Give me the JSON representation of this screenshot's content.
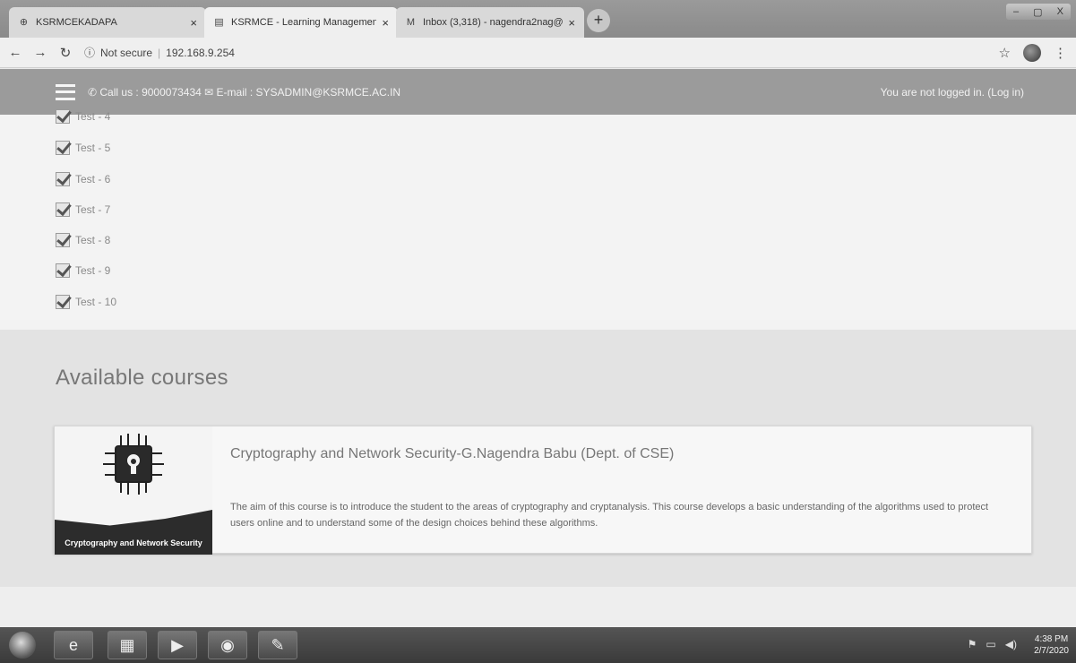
{
  "browser": {
    "tabs": [
      {
        "title": "KSRMCEKADAPA",
        "icon": "globe-icon"
      },
      {
        "title": "KSRMCE - Learning Managemen",
        "icon": "page-icon"
      },
      {
        "title": "Inbox (3,318) - nagendra2nag@",
        "icon": "gmail-icon"
      }
    ],
    "active_tab": 1,
    "new_tab_label": "+",
    "window_controls": [
      "–",
      "▢",
      "X"
    ],
    "address": {
      "security": "Not secure",
      "url": "192.168.9.254"
    }
  },
  "header": {
    "contact": "Call us : 9000073434 ✉ E-mail : SYSADMIN@KSRMCE.AC.IN",
    "login_status": "You are not logged in. (Log in)"
  },
  "tests": [
    {
      "label": "Test - 4"
    },
    {
      "label": "Test - 5"
    },
    {
      "label": "Test - 6"
    },
    {
      "label": "Test - 7"
    },
    {
      "label": "Test - 8"
    },
    {
      "label": "Test - 9"
    },
    {
      "label": "Test - 10"
    }
  ],
  "courses": {
    "heading": "Available courses",
    "items": [
      {
        "title": "Cryptography and Network Security-G.Nagendra Babu (Dept. of CSE)",
        "thumbnail_caption": "Cryptography and Network Security",
        "thumbnail_icon": "chip-lock-icon",
        "summary": "The aim of this course is to introduce the student to the areas of cryptography and cryptanalysis. This course develops a basic understanding of the algorithms used to protect users online and to understand some of the design choices behind these algorithms."
      }
    ]
  },
  "taskbar": {
    "apps": [
      "ie-icon",
      "folder-icon",
      "media-player-icon",
      "chrome-icon",
      "paint-icon"
    ],
    "time": "4:38 PM",
    "date": "2/7/2020"
  }
}
